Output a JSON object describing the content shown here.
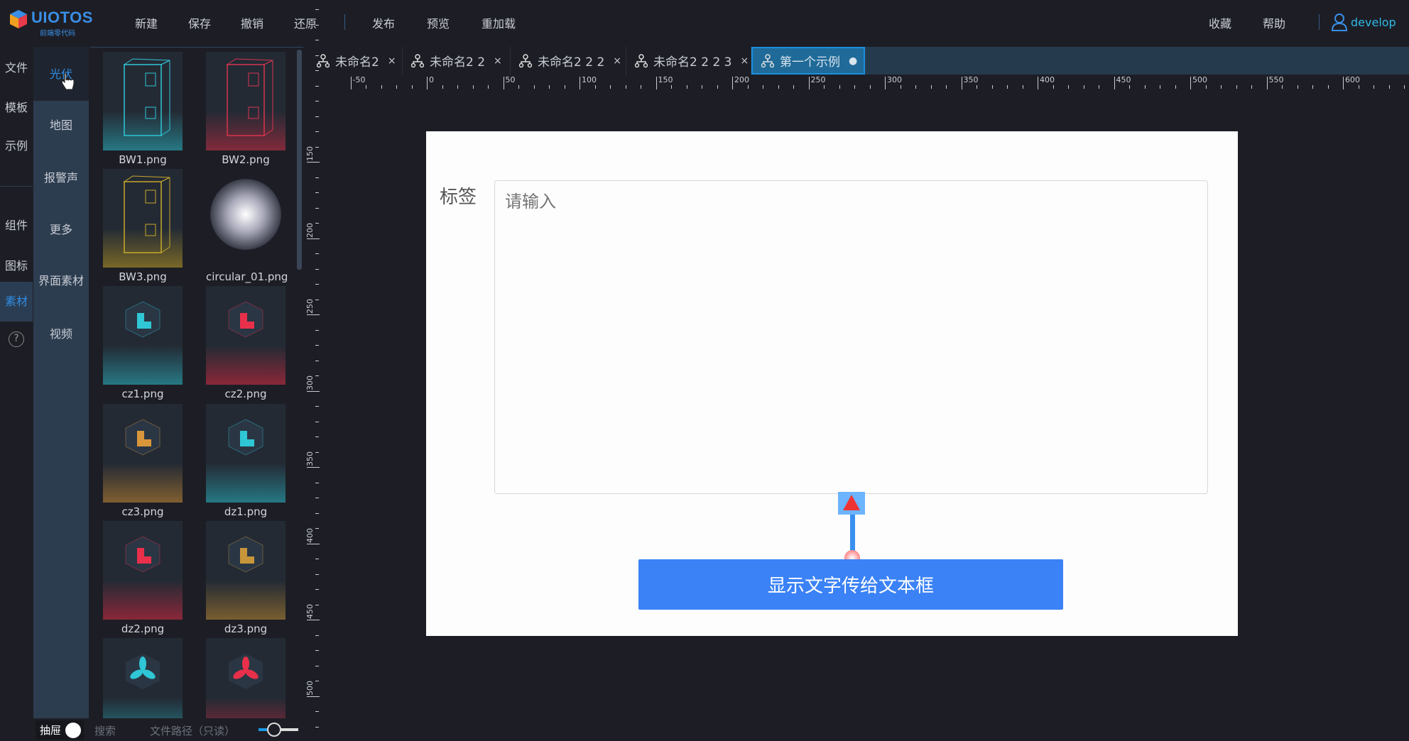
{
  "app": {
    "logo_title": "UIOTOS",
    "logo_subtitle": "前端零代码"
  },
  "menu": {
    "left": [
      "新建",
      "保存",
      "撤销",
      "还原"
    ],
    "right_group": [
      "发布",
      "预览",
      "重加载"
    ],
    "favorites": "收藏",
    "help": "帮助",
    "user": "develop"
  },
  "tabs": [
    {
      "label": "未命名2",
      "close": "×"
    },
    {
      "label": "未命名2 2",
      "close": "×"
    },
    {
      "label": "未命名2 2 2",
      "close": "×"
    },
    {
      "label": "未命名2 2 2 3",
      "close": "×"
    },
    {
      "label": "第一个示例",
      "close": "●",
      "active": true
    }
  ],
  "sidebar": {
    "primary": [
      "文件",
      "模板",
      "示例",
      "组件",
      "图标",
      "素材"
    ],
    "primary_active": "素材",
    "help_icon": "?",
    "secondary": [
      "光伏",
      "地图",
      "报警声",
      "更多",
      "界面素材",
      "视频"
    ],
    "secondary_active": "光伏"
  },
  "assets": [
    {
      "name": "BW1.png",
      "kind": "cabinet",
      "color": "#2fc6d6"
    },
    {
      "name": "BW2.png",
      "kind": "cabinet",
      "color": "#d8344f"
    },
    {
      "name": "BW3.png",
      "kind": "cabinet",
      "color": "#c8a82a"
    },
    {
      "name": "circular_01.png",
      "kind": "glow",
      "color": "#e8e8f0"
    },
    {
      "name": "cz1.png",
      "kind": "cube",
      "color": "#2fc6d6"
    },
    {
      "name": "cz2.png",
      "kind": "cube",
      "color": "#e8304a"
    },
    {
      "name": "cz3.png",
      "kind": "cube",
      "color": "#d8963a"
    },
    {
      "name": "dz1.png",
      "kind": "cube",
      "color": "#2fc6d6"
    },
    {
      "name": "dz2.png",
      "kind": "cube",
      "color": "#e8304a"
    },
    {
      "name": "dz3.png",
      "kind": "cube",
      "color": "#c8963a"
    },
    {
      "kind": "fan",
      "color": "#2fc6d6"
    },
    {
      "kind": "fan",
      "color": "#e8304a"
    }
  ],
  "bottom": {
    "drawer_label": "抽屉",
    "search_placeholder": "搜索",
    "path_placeholder": "文件路径（只读）",
    "zoom_slider": 0.25
  },
  "rulers": {
    "horizontal": [
      "-50",
      "0",
      "50",
      "100",
      "150",
      "200",
      "250",
      "300",
      "350",
      "400",
      "450",
      "500",
      "550",
      "600"
    ],
    "vertical": [
      "150",
      "200",
      "250",
      "300",
      "350",
      "400",
      "450",
      "500"
    ]
  },
  "canvas": {
    "label": "标签",
    "textarea_placeholder": "请输入",
    "button_label": "显示文字传给文本框"
  },
  "colors": {
    "accent": "#3b82f6",
    "brand": "#3a8ee6",
    "active_tab": "#1f6a98"
  }
}
